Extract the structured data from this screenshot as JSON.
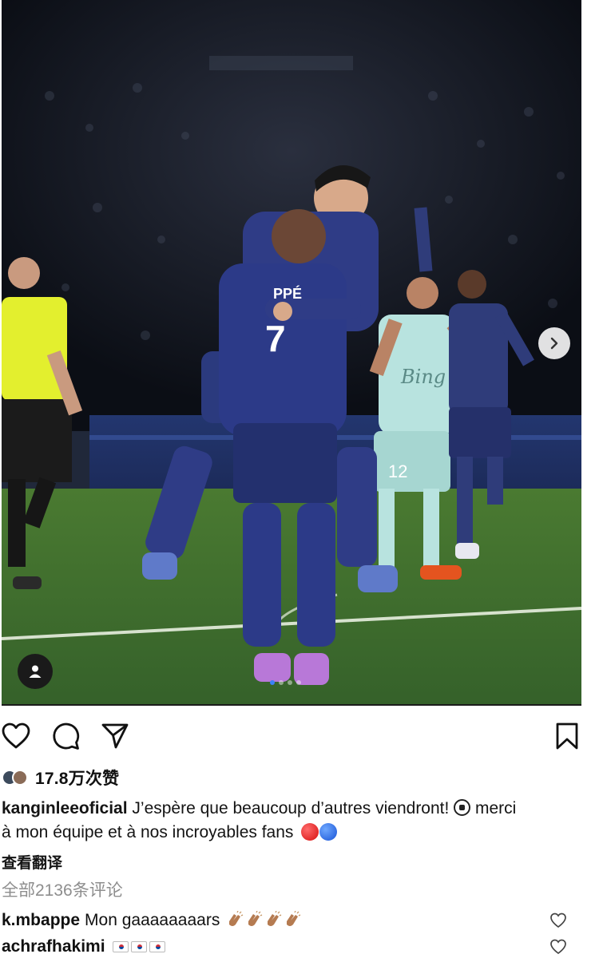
{
  "post": {
    "likes_count": "17.8万次赞",
    "caption": {
      "username": "kanginleeoficial",
      "text_line1": " J’espère que beaucoup d’autres viendront! ",
      "text_mid": " merci",
      "text_line2": "à mon équipe et à nos incroyables fans "
    },
    "translate_label": "查看翻译",
    "all_comments_label": "全部2136条评论"
  },
  "comments": [
    {
      "username": "k.mbappe",
      "text": "Mon gaaaaaaaars"
    },
    {
      "username": "achrafhakimi",
      "text": ""
    }
  ],
  "photo": {
    "jersey_name": "PPÉ",
    "jersey_number": "7",
    "opponent_number": "12",
    "sponsor": "Bing",
    "carousel_index": 1,
    "carousel_total": 4
  },
  "icons": {
    "like": "heart-icon",
    "comment": "comment-bubble-icon",
    "share": "paper-plane-icon",
    "save": "bookmark-icon",
    "next": "chevron-right-icon",
    "tag": "user-tag-icon"
  },
  "colors": {
    "accent": "#3b82f6",
    "muted": "#8e8e8e",
    "psg_navy": "#2a3f86",
    "grass": "#3f6e2b"
  }
}
